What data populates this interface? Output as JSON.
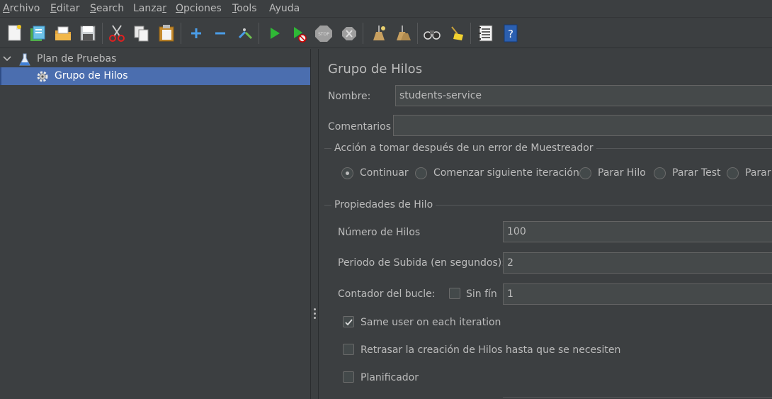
{
  "menu": [
    {
      "label": "Archivo",
      "mnemonic_index": 0
    },
    {
      "label": "Editar",
      "mnemonic_index": 0
    },
    {
      "label": "Search",
      "mnemonic_index": 0
    },
    {
      "label": "Lanzar",
      "mnemonic_index": 5
    },
    {
      "label": "Opciones",
      "mnemonic_index": 0
    },
    {
      "label": "Tools",
      "mnemonic_index": 0
    },
    {
      "label": "Ayuda",
      "mnemonic_index": -1
    }
  ],
  "toolbar": {
    "icons": [
      "new-icon",
      "templates-icon",
      "open-icon",
      "save-icon",
      "cut-icon",
      "copy-icon",
      "paste-icon",
      "expand-icon",
      "collapse-icon",
      "toggle-icon",
      "start-icon",
      "start-no-pauses-icon",
      "stop-icon",
      "shutdown-icon",
      "clear-icon",
      "clear-all-icon",
      "search-icon",
      "reset-search-icon",
      "function-helper-icon",
      "help-icon"
    ]
  },
  "tree": {
    "root_label": "Plan de Pruebas",
    "child_label": "Grupo de Hilos"
  },
  "panel": {
    "title": "Grupo de Hilos",
    "name_label": "Nombre:",
    "name_value": "students-service",
    "comments_label": "Comentarios",
    "comments_value": "",
    "error_group_title": "Acción a tomar después de un error de Muestreador",
    "error_options": [
      {
        "label": "Continuar",
        "selected": true
      },
      {
        "label": "Comenzar siguiente iteración",
        "selected": false
      },
      {
        "label": "Parar Hilo",
        "selected": false
      },
      {
        "label": "Parar Test",
        "selected": false
      },
      {
        "label": "Parar",
        "selected": false
      }
    ],
    "thread_group_title": "Propiedades de Hilo",
    "threads_label": "Número de Hilos",
    "threads_value": "100",
    "rampup_label": "Periodo de Subida (en segundos):",
    "rampup_value": "2",
    "loop_label": "Contador del bucle:",
    "infinite_label": "Sin fín",
    "infinite_checked": false,
    "loop_value": "1",
    "same_user_label": "Same user on each iteration",
    "same_user_checked": true,
    "delay_label": "Retrasar la creación de Hilos hasta que se necesiten",
    "delay_checked": false,
    "scheduler_label": "Planificador",
    "scheduler_checked": false
  },
  "colors": {
    "background": "#3c3f41",
    "selection": "#4b6eaf",
    "text": "#bbbbbb",
    "field": "#45494a"
  }
}
